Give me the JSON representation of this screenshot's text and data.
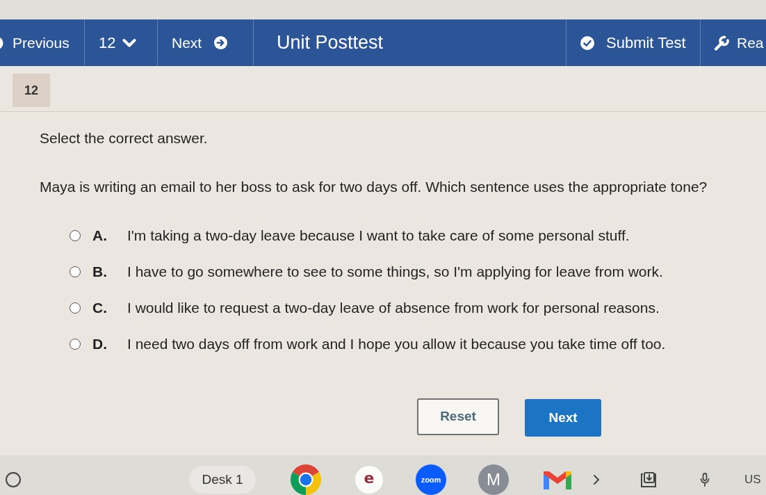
{
  "header": {
    "nav": [
      {
        "kind": "previous",
        "label": "Previous"
      },
      {
        "kind": "dropdown",
        "label": "12"
      },
      {
        "kind": "next",
        "label": "Next"
      }
    ],
    "title": "Unit Posttest",
    "actions": [
      {
        "kind": "submit",
        "label": "Submit Test"
      },
      {
        "kind": "tool",
        "label": "Rea"
      }
    ]
  },
  "question": {
    "number": "12",
    "instruction": "Select the correct answer.",
    "prompt": "Maya is writing an email to her boss to ask for two days off. Which sentence uses the appropriate tone?",
    "options": [
      {
        "letter": "A.",
        "text": "I'm taking a two-day leave because I want to take care of some personal stuff.",
        "selected": false
      },
      {
        "letter": "B.",
        "text": "I have to go somewhere to see to some things, so I'm applying for leave from work.",
        "selected": false
      },
      {
        "letter": "C.",
        "text": "I would like to request a two-day leave of absence from work for personal reasons.",
        "selected": false
      },
      {
        "letter": "D.",
        "text": "I need two days off from work and I hope you allow it because you take time off too.",
        "selected": false
      }
    ]
  },
  "buttons": [
    {
      "kind": "secondary",
      "label": "Reset"
    },
    {
      "kind": "primary",
      "label": "Next"
    }
  ],
  "taskbar": {
    "desk": "Desk 1",
    "apps": [
      {
        "kind": "chrome"
      },
      {
        "kind": "letter",
        "label": "e"
      },
      {
        "kind": "zoom",
        "label": "zoom"
      },
      {
        "kind": "avatar",
        "label": "M"
      },
      {
        "kind": "mail"
      }
    ],
    "tray": [
      {
        "kind": "chevron"
      },
      {
        "kind": "download"
      },
      {
        "kind": "mic"
      }
    ],
    "locale": "US"
  }
}
